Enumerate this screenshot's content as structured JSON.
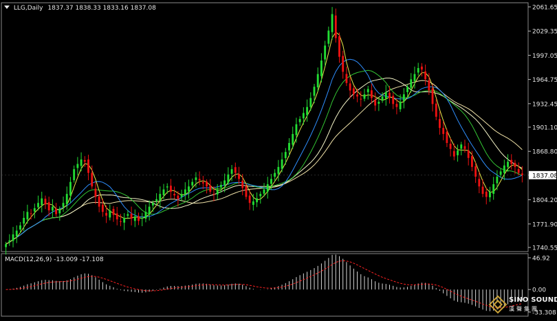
{
  "header": {
    "symbol_tf": "LLG,Daily",
    "ohlc": "1837.37 1838.33 1833.16 1837.08"
  },
  "price_axis": {
    "ticks": [
      "2061.65",
      "2029.35",
      "1997.05",
      "1964.75",
      "1932.45",
      "1901.10",
      "1868.80",
      "1837.08",
      "1804.20",
      "1771.90",
      "1740.55"
    ],
    "current": "1837.08"
  },
  "macd": {
    "label": "MACD(12,26,9) -13.009 -17.108",
    "ticks": [
      "46.92",
      "0.00",
      "-33.308"
    ]
  },
  "watermark": {
    "text_en": "SINO SOUND",
    "text_cn": "漢聲集團"
  },
  "colors": {
    "background": "#000000",
    "bull_candle": "#22dd33",
    "bear_candle": "#ee1111",
    "ma_fast": "#e8e84a",
    "ma_mid": "#2f8fff",
    "ma_slow": "#34c734",
    "ma_slower": "#f5f5c8",
    "ma_slowest": "#f0e2a8",
    "macd_signal": "#ff2222",
    "macd_hist": "#d8d8d8"
  },
  "chart_data": {
    "type": "candlestick",
    "symbol": "LLG",
    "timeframe": "Daily",
    "ylim": [
      1740.55,
      2061.65
    ],
    "last_close": 1837.08,
    "moving_average_colors": [
      "yellow",
      "blue",
      "green",
      "white",
      "cream"
    ],
    "closes": [
      1745,
      1750,
      1758,
      1763,
      1770,
      1780,
      1788,
      1786,
      1793,
      1800,
      1806,
      1798,
      1790,
      1795,
      1785,
      1792,
      1800,
      1812,
      1828,
      1845,
      1852,
      1858,
      1855,
      1840,
      1822,
      1808,
      1795,
      1788,
      1783,
      1790,
      1784,
      1778,
      1775,
      1780,
      1785,
      1779,
      1782,
      1776,
      1780,
      1788,
      1795,
      1800,
      1805,
      1812,
      1818,
      1822,
      1815,
      1810,
      1805,
      1812,
      1818,
      1822,
      1828,
      1834,
      1830,
      1826,
      1822,
      1815,
      1812,
      1818,
      1824,
      1830,
      1838,
      1845,
      1840,
      1832,
      1820,
      1808,
      1800,
      1802,
      1806,
      1812,
      1818,
      1825,
      1832,
      1840,
      1848,
      1858,
      1868,
      1880,
      1892,
      1905,
      1912,
      1920,
      1928,
      1940,
      1955,
      1972,
      1990,
      2010,
      2030,
      2052,
      2020,
      1995,
      1975,
      1960,
      1950,
      1945,
      1942,
      1938,
      1945,
      1952,
      1940,
      1930,
      1935,
      1942,
      1948,
      1940,
      1932,
      1928,
      1935,
      1945,
      1955,
      1965,
      1972,
      1980,
      1978,
      1965,
      1950,
      1932,
      1915,
      1900,
      1892,
      1880,
      1872,
      1862,
      1870,
      1878,
      1872,
      1860,
      1848,
      1835,
      1822,
      1812,
      1808,
      1815,
      1825,
      1835,
      1842,
      1850,
      1855,
      1852,
      1848,
      1840,
      1837.08
    ],
    "macd": {
      "name": "MACD(12,26,9)",
      "main": -13.009,
      "signal": -17.108,
      "ylim": [
        -33.308,
        46.92
      ]
    }
  }
}
